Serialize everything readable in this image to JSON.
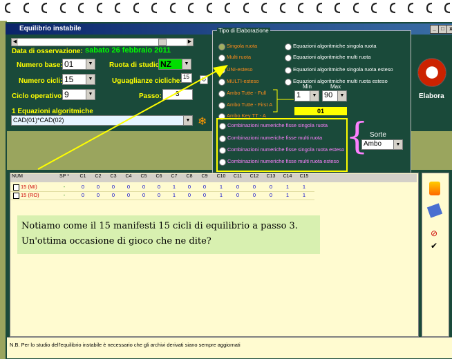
{
  "window": {
    "title": "Equilibrio instabile"
  },
  "header": {
    "date_label": "Data di osservazione:",
    "date_value": "sabato 26 febbraio 2011",
    "numero_base_label": "Numero base:",
    "numero_base_value": "01",
    "ruota_label": "Ruota di studio:",
    "ruota_value": "NZ",
    "numero_cicli_label": "Numero cicli:",
    "numero_cicli_value": "15",
    "uguaglianze_label": "Uguaglianze cicliche:",
    "uguaglianze_value": "15",
    "ciclo_label": "Ciclo operativo:",
    "ciclo_value": "9",
    "passo_label": "Passo:",
    "passo_value": "3",
    "equazioni_label": "1 Equazioni algoritmiche",
    "equazione_value": "CAD(01)*CAD(02)"
  },
  "tipo": {
    "title": "Tipo di Elaborazione",
    "left_options": [
      "Singola ruota",
      "Multi ruota",
      "UNI-esteso",
      "MULTI-esteso",
      "Ambo Tutte - Full",
      "Ambo Tutte - First A",
      "Ambo Key TT - A"
    ],
    "right_options": [
      "Equazioni algoritmiche singola ruota",
      "Equazioni algoritmiche multi ruota",
      "Equazioni algoritmiche singola ruota esteso",
      "Equazioni algoritmiche multi ruota esteso"
    ],
    "combo_options": [
      "Combinazioni numeriche fisse singola ruota",
      "Combinazioni numeriche fisse multi ruota",
      "Combinazioni numeriche fisse singola ruota esteso",
      "Combinazioni numeriche fisse multi ruota esteso"
    ],
    "min_label": "Min",
    "max_label": "Max",
    "min_value": "1",
    "max_value": "90",
    "key_value": "01",
    "sorte_label": "Sorte",
    "sorte_value": "Ambo"
  },
  "elabora_label": "Elabora",
  "grid": {
    "columns": [
      "NUM",
      "SP *",
      "C1",
      "C2",
      "C3",
      "C4",
      "C5",
      "C6",
      "C7",
      "C8",
      "C9",
      "C10",
      "C11",
      "C12",
      "C13",
      "C14",
      "C15"
    ],
    "rows": [
      {
        "num": "15  (MI)",
        "sp": "-",
        "cells": [
          "0",
          "0",
          "0",
          "0",
          "0",
          "0",
          "1",
          "0",
          "0",
          "1",
          "0",
          "0",
          "0",
          "1",
          "1"
        ]
      },
      {
        "num": "15  (RO)",
        "sp": "-",
        "cells": [
          "0",
          "0",
          "0",
          "0",
          "0",
          "0",
          "1",
          "0",
          "0",
          "1",
          "0",
          "0",
          "0",
          "1",
          "1"
        ]
      }
    ]
  },
  "note": {
    "line1": "Notiamo come il 15 manifesti 15 cicli di equilibrio a passo 3.",
    "line2": "Un'ottima occasione di gioco che ne dite?"
  },
  "status": "N.B. Per lo studio dell'equilibrio instabile è necessario che gli archivi derivati siano sempre aggiornati",
  "colors": {
    "panel": "#1a4a3a",
    "label": "#ffff00",
    "grid_bg": "#fffbd0",
    "olive": "#9aa55e"
  }
}
